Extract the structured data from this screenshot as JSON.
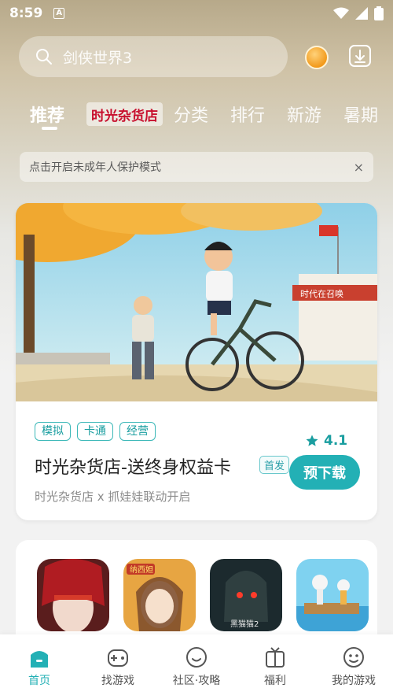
{
  "status_bar": {
    "time": "8:59",
    "notification_letter": "A"
  },
  "search": {
    "placeholder": "剑侠世界3"
  },
  "tabs": [
    {
      "label": "推荐",
      "active": true
    },
    {
      "label": "时光杂货店",
      "brand": true
    },
    {
      "label": "分类"
    },
    {
      "label": "排行"
    },
    {
      "label": "新游"
    },
    {
      "label": "暑期"
    }
  ],
  "notice": {
    "text": "点击开启未成年人保护模式",
    "close": "×"
  },
  "featured": {
    "tags": [
      "模拟",
      "卡通",
      "经营"
    ],
    "title": "时光杂货店-送终身权益卡",
    "badge": "首发",
    "subtitle": "时光杂货店 x 抓娃娃联动开启",
    "rating": "4.1",
    "button": "预下载",
    "banner_sign": "时代在召唤"
  },
  "game_icons": [
    {
      "name": "game-icon-red-veil"
    },
    {
      "name": "game-icon-anime-girl",
      "caption": "纳西妲"
    },
    {
      "name": "game-icon-horror",
      "caption": "黑猫猫2"
    },
    {
      "name": "game-icon-raft"
    }
  ],
  "bottom_nav": [
    {
      "label": "首页",
      "icon": "home-icon",
      "active": true
    },
    {
      "label": "找游戏",
      "icon": "gamepad-icon"
    },
    {
      "label": "社区·攻略",
      "icon": "community-icon"
    },
    {
      "label": "福利",
      "icon": "gift-icon"
    },
    {
      "label": "我的游戏",
      "icon": "my-games-icon"
    }
  ],
  "colors": {
    "accent": "#23b0b5",
    "tag": "#1a9ea0"
  }
}
